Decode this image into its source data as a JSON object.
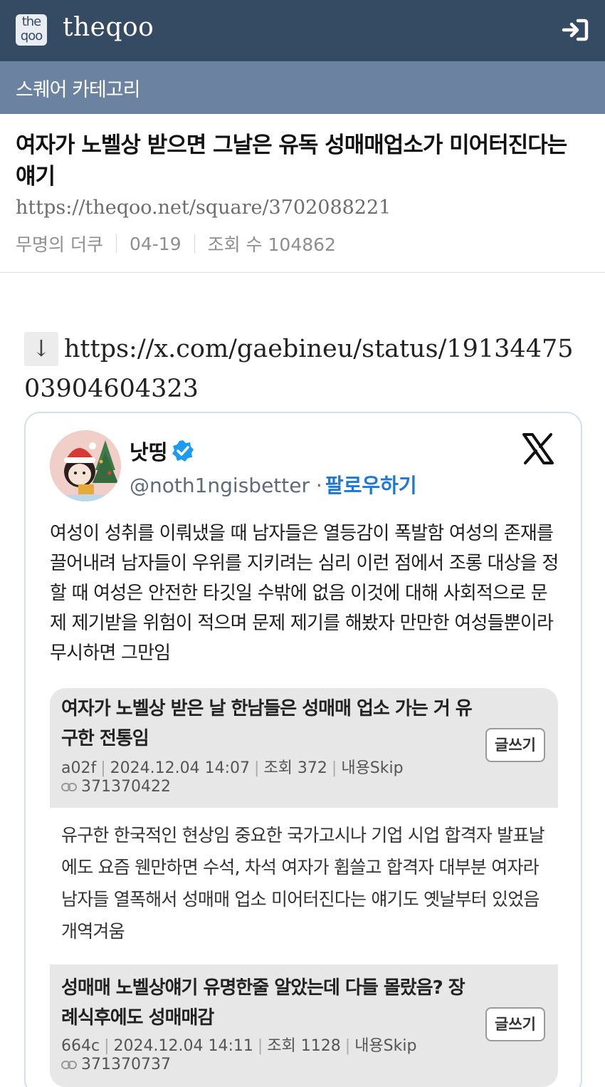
{
  "header": {
    "logo_line1": "the",
    "logo_line2": "qoo",
    "brand": "theqoo",
    "login_icon": "login-arrow-icon"
  },
  "category_bar": {
    "label": "스퀘어 카테고리"
  },
  "article": {
    "title": "여자가 노벨상 받으면 그날은 유독 성매매업소가 미어터진다는 얘기",
    "url": "https://theqoo.net/square/3702088221",
    "author": "무명의 더쿠",
    "date": "04-19",
    "views": "조회 수 104862",
    "source_arrow": "↓",
    "source_link": "https://x.com/gaebineu/status/1913447503904604323"
  },
  "tweet": {
    "display_name": "낫띵",
    "handle": "@noth1ngisbetter",
    "separator": "·",
    "follow_label": "팔로우하기",
    "verified_icon": "verified-badge-icon",
    "platform_icon": "x-logo-icon",
    "text": "여성이 성취를 이뤄냈을 때 남자들은 열등감이 폭발함 여성의 존재를 끌어내려 남자들이 우위를 지키려는 심리 이런 점에서 조롱 대상을 정할 때 여성은 안전한 타깃일 수밖에 없음 이것에 대해 사회적으로 문제 제기받을 위험이 적으며 문제 제기를 해봤자 만만한 여성들뿐이라 무시하면 그만임",
    "posts": [
      {
        "title": "여자가 노벨상 받은 날 한남들은 성매매 업소 가는 거 유구한 전통임",
        "id_code": "a02f",
        "datetime": "2024.12.04 14:07",
        "views": "조회 372",
        "skip": "내용Skip",
        "number": "371370422",
        "write_label": "글쓰기",
        "body": "유구한 한국적인 현상임 중요한 국가고시나 기업 시업 합격자 발표날에도 요즘 웬만하면 수석, 차석 여자가 휩쓸고 합격자 대부분 여자라 남자들 열폭해서 성매매 업소 미어터진다는 얘기도 옛날부터 있었음 개역겨움"
      },
      {
        "title": "성매매 노벨상얘기 유명한줄 알았는데 다들 몰랐음? 장례식후에도 성매매감",
        "id_code": "664c",
        "datetime": "2024.12.04 14:11",
        "views": "조회 1128",
        "skip": "내용Skip",
        "number": "371370737",
        "write_label": "글쓰기"
      }
    ]
  }
}
